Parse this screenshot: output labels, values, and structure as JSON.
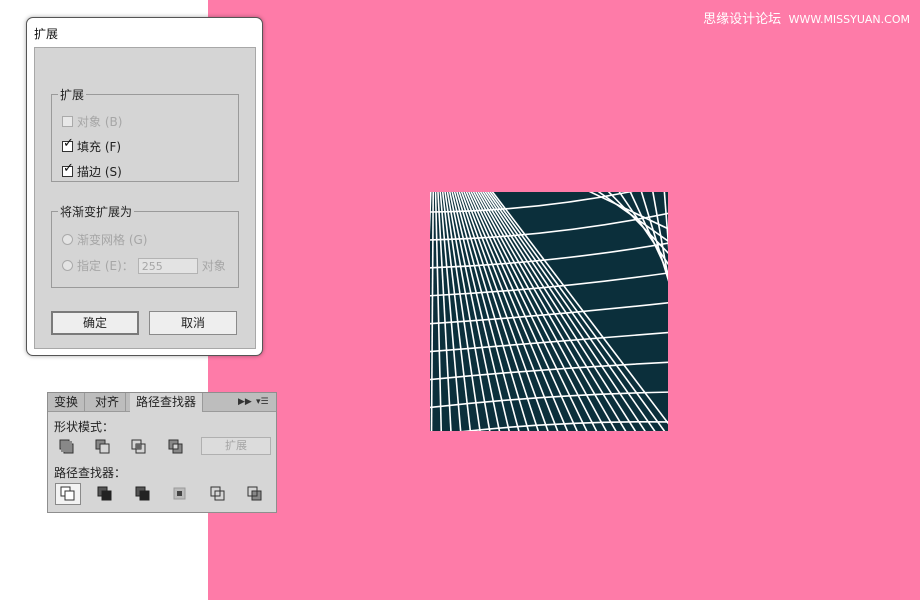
{
  "watermark": {
    "site_cn": "思缘设计论坛",
    "site_url": "WWW.MISSYUAN.COM"
  },
  "dialog": {
    "title": "扩展",
    "expand_group": {
      "legend": "扩展",
      "object_label": "对象 (B)",
      "fill_label": "填充 (F)",
      "stroke_label": "描边 (S)",
      "object_checked": false,
      "fill_checked": true,
      "stroke_checked": true
    },
    "gradient_group": {
      "legend": "将渐变扩展为",
      "mesh_label": "渐变网格 (G)",
      "specify_label": "指定 (E)：",
      "specify_value": "255",
      "objects_label": "对象"
    },
    "ok_label": "确定",
    "cancel_label": "取消"
  },
  "panel": {
    "tabs": [
      "变换",
      "对齐",
      "路径查找器"
    ],
    "active_tab": 2,
    "shape_modes_label": "形状模式：",
    "expand_label": "扩展",
    "pathfinders_label": "路径查找器：",
    "shape_mode_icons": [
      "unite-icon",
      "minus-front-icon",
      "intersect-icon",
      "exclude-icon"
    ],
    "pathfinder_icons": [
      "divide-icon",
      "trim-icon",
      "merge-icon",
      "crop-icon",
      "outline-icon",
      "minus-back-icon"
    ]
  },
  "colors": {
    "canvas": "#fe7ba8",
    "artwork": "#0b2f3b",
    "artwork_lines": "#ffffff"
  }
}
